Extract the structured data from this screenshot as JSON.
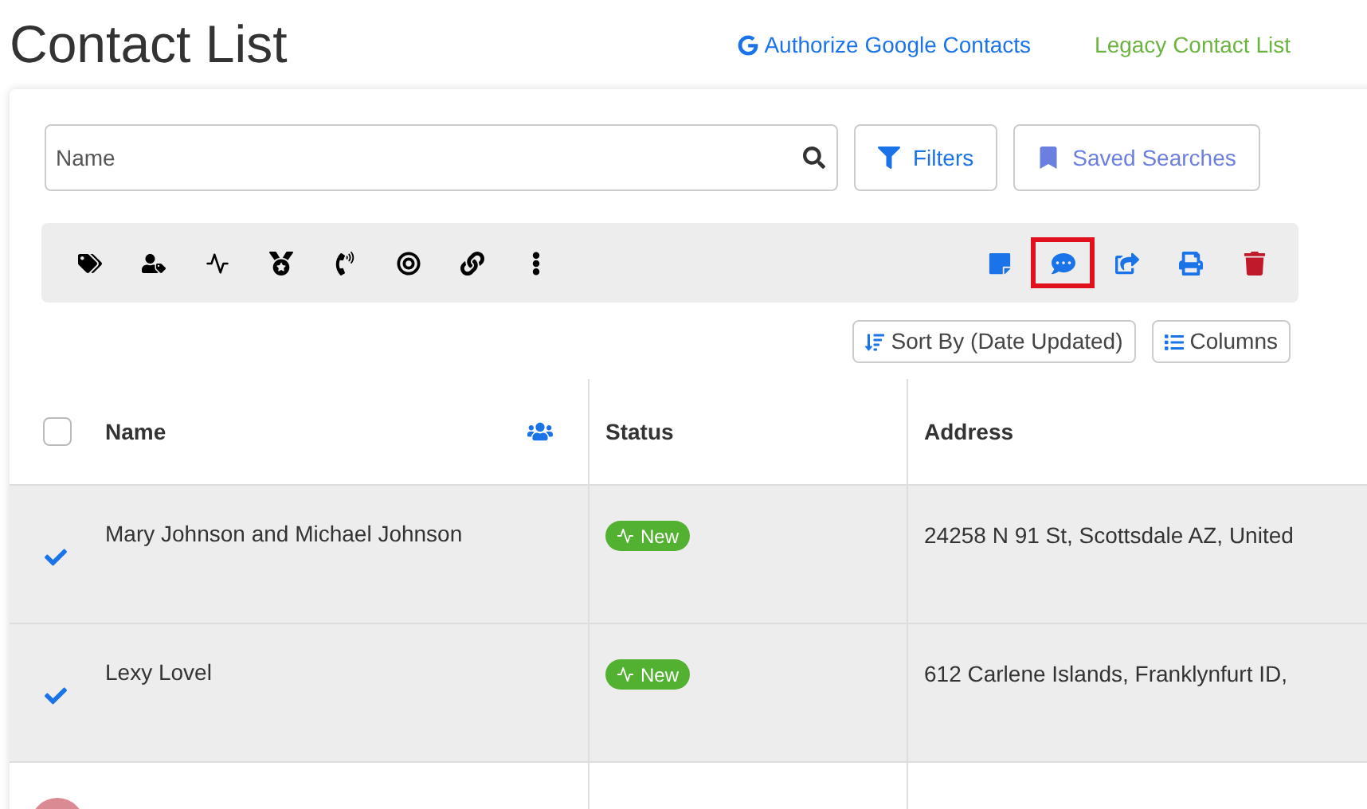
{
  "page": {
    "title": "Contact List"
  },
  "header_links": [
    {
      "kind": "google",
      "label": "Authorize Google Contacts"
    },
    {
      "kind": "legacy",
      "label": "Legacy Contact List"
    }
  ],
  "search": {
    "placeholder": "Name"
  },
  "buttons": [
    {
      "kind": "filter",
      "label": "Filters"
    },
    {
      "kind": "saved",
      "label": "Saved Searches"
    }
  ],
  "toolbar": {
    "left_tools": [
      {
        "kind": "tags",
        "highlighted": false
      },
      {
        "kind": "assign",
        "highlighted": false
      },
      {
        "kind": "pulse",
        "highlighted": false
      },
      {
        "kind": "medal",
        "highlighted": false
      },
      {
        "kind": "call",
        "highlighted": false
      },
      {
        "kind": "target",
        "highlighted": false
      },
      {
        "kind": "link",
        "highlighted": false
      },
      {
        "kind": "more",
        "highlighted": false
      }
    ],
    "right_tools": [
      {
        "kind": "note",
        "highlighted": false
      },
      {
        "kind": "chat",
        "highlighted": true
      },
      {
        "kind": "share",
        "highlighted": false
      },
      {
        "kind": "print",
        "highlighted": false
      },
      {
        "kind": "delete",
        "highlighted": false
      }
    ]
  },
  "sort_button": "Sort By (Date Updated)",
  "columns_button": "Columns",
  "table": {
    "select_all_checked": false,
    "columns": [
      "Name",
      "Status",
      "Address"
    ],
    "rows": [
      {
        "name": "Mary Johnson and Michael Johnson",
        "status": "New",
        "address": "24258 N 91 St, Scottsdale AZ, United",
        "selected": true
      },
      {
        "name": "Lexy Lovel",
        "status": "New",
        "address": "612 Carlene Islands, Franklynfurt ID,",
        "selected": true
      },
      {
        "selected": false
      }
    ]
  }
}
